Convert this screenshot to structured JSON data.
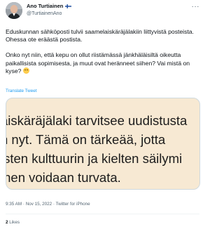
{
  "author": {
    "display_name": "Ano Turtiainen",
    "handle": "@TurtiainenAno",
    "flag_icon": "finland-flag-icon"
  },
  "more_icon": "more-options-icon",
  "text": {
    "paragraph1": "Eduskunnan sähköposti tulvii saamelaiskäräjälakiin liittyvistä posteista. Ohessa ote eräästä postista.",
    "paragraph2": "Onko nyt niin, että kepu on ollut riistämässä jänkhäläisiltä oikeutta paikallisista sopimisesta, ja muut ovat heränneet siihen? Vai mistä on kyse?",
    "emoji": "thinking-face-emoji"
  },
  "translate_label": "Translate Tweet",
  "media": {
    "lines": [
      "aiskäräjälaki tarvitsee uudistusta",
      "n nyt. Tämä on tärkeää, jotta",
      "isten kulttuurin ja kielten säilymi",
      "inen voidaan turvata."
    ],
    "background": "#f7e9d3"
  },
  "meta": {
    "time": "9:35 AM",
    "separator1": " · ",
    "date": "Nov 15, 2022",
    "separator2": " · ",
    "source": "Twitter for iPhone"
  },
  "stats": {
    "likes_count": "2",
    "likes_label": " Likes"
  },
  "colors": {
    "text": "#0f1419",
    "secondary": "#536471",
    "link": "#1d9bf0"
  }
}
